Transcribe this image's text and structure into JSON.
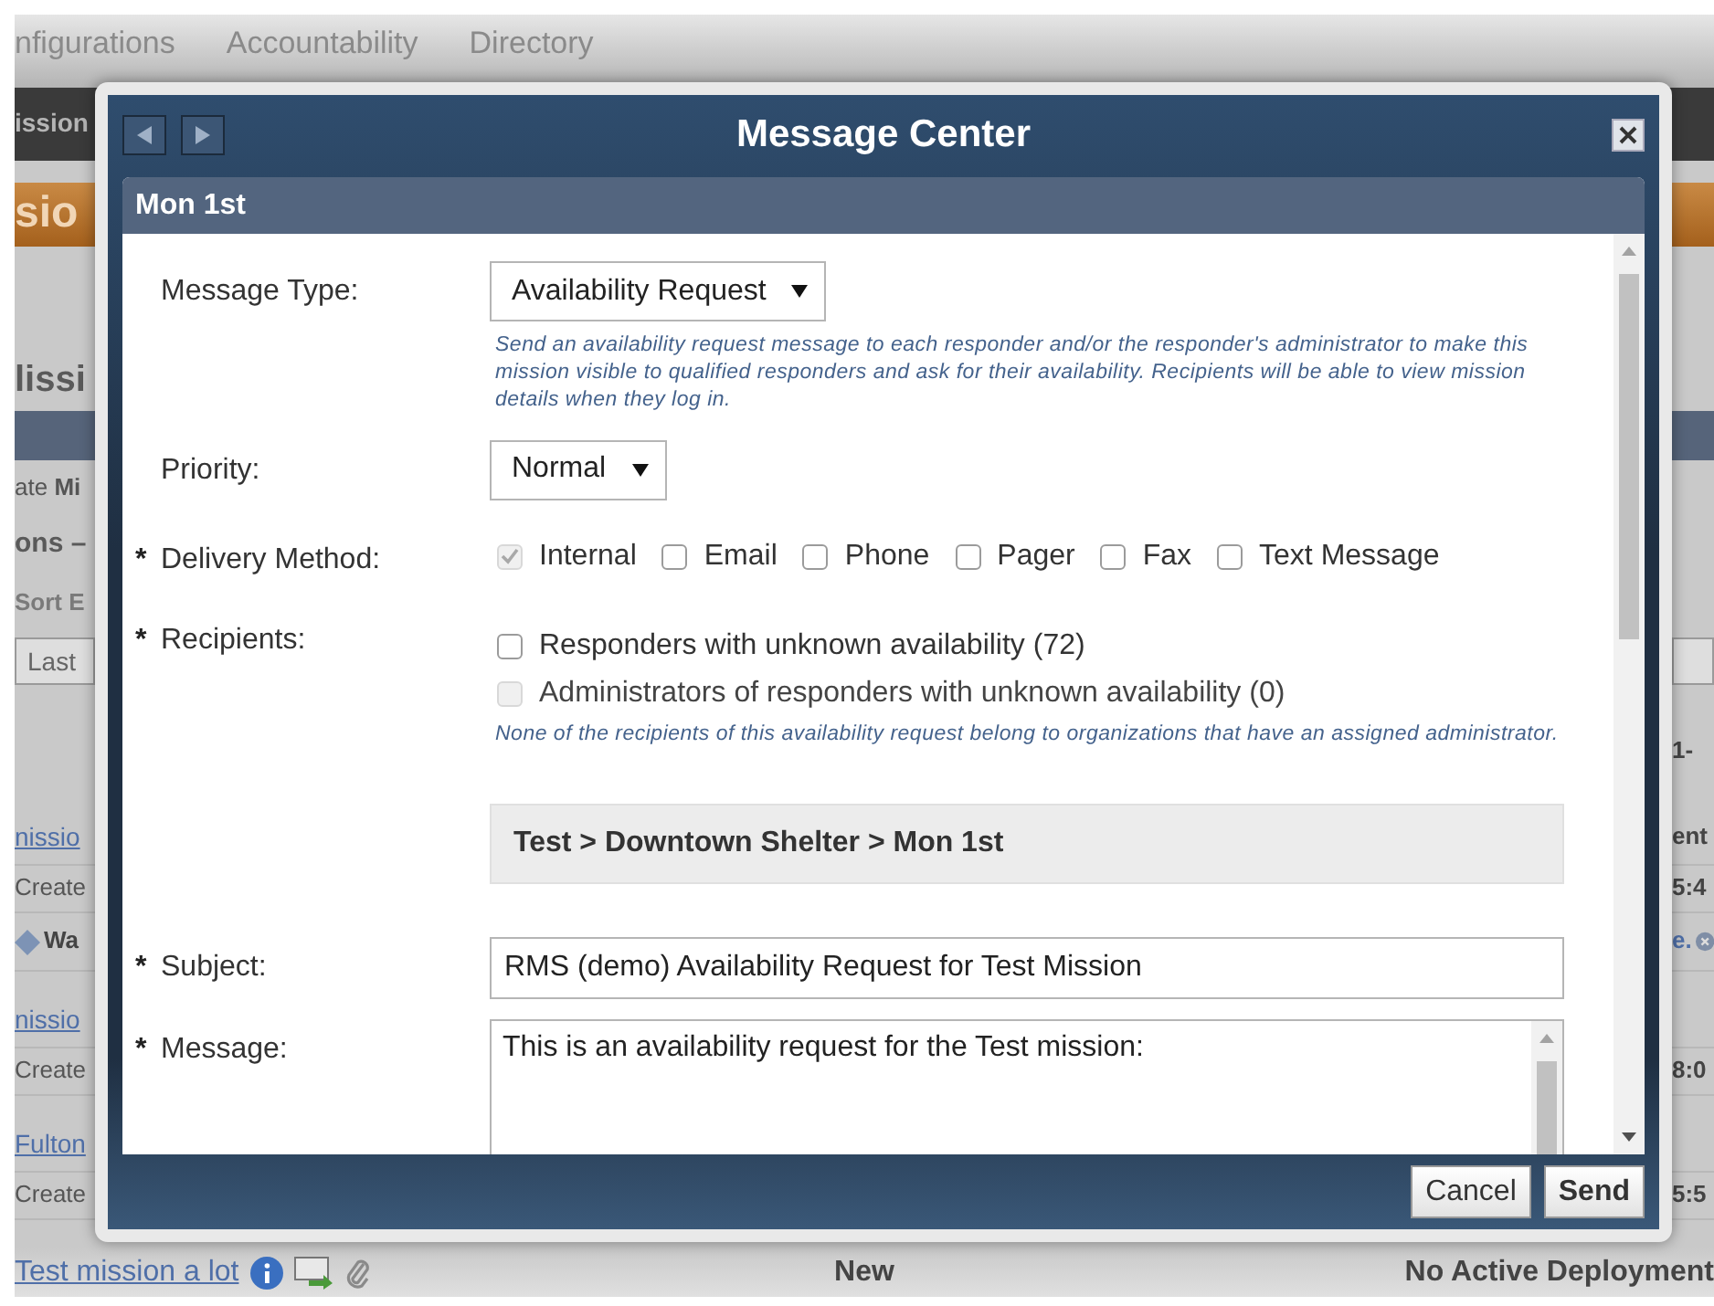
{
  "nav": [
    {
      "label": "nfigurations"
    },
    {
      "label": "Accountability"
    },
    {
      "label": "Directory"
    }
  ],
  "background_rows": [
    {
      "kind": "bar",
      "left": "ission"
    },
    {
      "kind": "banner",
      "left": "sio"
    },
    {
      "kind": "heading",
      "left": "lissi"
    },
    {
      "kind": "band"
    },
    {
      "kind": "text",
      "left": "ate **Mi**"
    },
    {
      "kind": "subheading",
      "left": "ons –"
    },
    {
      "kind": "label",
      "left": "Sort E"
    },
    {
      "kind": "select",
      "left": "Last"
    },
    {
      "kind": "pager",
      "right": "1-"
    },
    {
      "kind": "link",
      "left": "nissio",
      "right": "ent"
    },
    {
      "kind": "meta",
      "left": "Create",
      "right": "5:4"
    },
    {
      "kind": "actions",
      "left": "Wa",
      "right": "e."
    },
    {
      "kind": "gap"
    },
    {
      "kind": "link",
      "left": "nissio"
    },
    {
      "kind": "meta",
      "left": "Create",
      "right": "8:0"
    },
    {
      "kind": "gap"
    },
    {
      "kind": "link",
      "left": "Fulton"
    },
    {
      "kind": "meta",
      "left": "Create",
      "right": "5:5"
    }
  ],
  "page_footer": {
    "link": "Test mission a lot",
    "status": "New",
    "deployment": "No Active Deployment"
  },
  "dialog": {
    "title": "Message Center",
    "section": "Mon 1st",
    "fields": [
      {
        "kind": "select",
        "label": "Message Type:",
        "value": "Availability Request",
        "help": "Send an availability request message to each responder and/or the responder's administrator to make this mission visible to qualified responders and ask for their availability. Recipients will be able to view mission details when they log in."
      },
      {
        "kind": "select",
        "label": "Priority:",
        "value": "Normal"
      },
      {
        "kind": "inline_checks",
        "mark": "*",
        "label": "Delivery Method:",
        "options": [
          {
            "label": "Internal",
            "checked": true,
            "disabled": true
          },
          {
            "label": "Email",
            "checked": false,
            "disabled": false
          },
          {
            "label": "Phone",
            "checked": false,
            "disabled": false
          },
          {
            "label": "Pager",
            "checked": false,
            "disabled": false
          },
          {
            "label": "Fax",
            "checked": false,
            "disabled": false
          },
          {
            "label": "Text Message",
            "checked": false,
            "disabled": false
          }
        ]
      },
      {
        "kind": "stacked_checks",
        "mark": "*",
        "label": "Recipients:",
        "options": [
          {
            "label": "Responders with unknown availability (72)",
            "checked": false,
            "disabled": false
          },
          {
            "label": "Administrators of responders with unknown availability (0)",
            "checked": false,
            "disabled": true
          }
        ],
        "help": "None of the recipients of this availability request belong to organizations that have an assigned administrator."
      },
      {
        "kind": "breadcrumb",
        "text": "Test > Downtown Shelter > Mon 1st"
      },
      {
        "kind": "text",
        "mark": "*",
        "label": "Subject:",
        "value": "RMS (demo) Availability Request for Test Mission"
      },
      {
        "kind": "textarea",
        "mark": "*",
        "label": "Message:",
        "value": "This is an availability request for the Test mission:"
      }
    ],
    "buttons": [
      {
        "label": "Cancel",
        "primary": false
      },
      {
        "label": "Send",
        "primary": true
      }
    ]
  }
}
